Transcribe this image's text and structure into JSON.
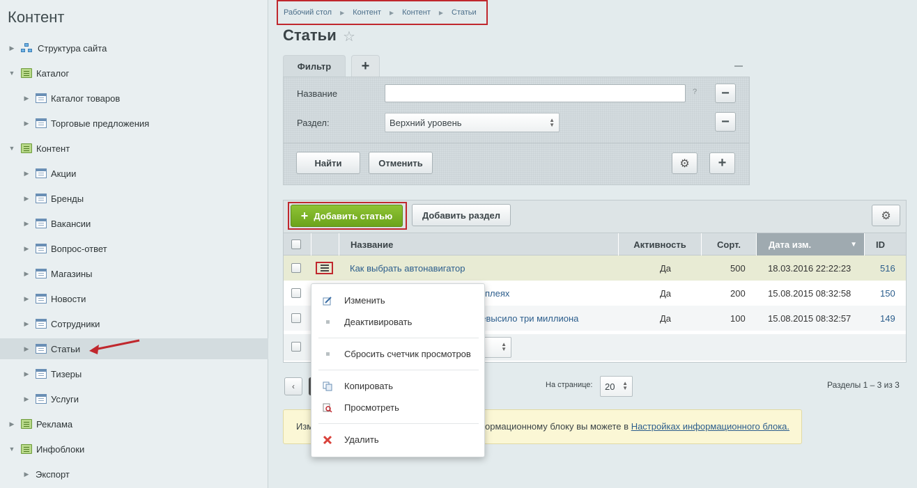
{
  "sidebar": {
    "title": "Контент",
    "items": [
      {
        "label": "Структура сайта",
        "arrow": "▶"
      },
      {
        "label": "Каталог",
        "arrow": "▼"
      },
      {
        "label": "Каталог товаров",
        "arrow": "▶"
      },
      {
        "label": "Торговые предложения",
        "arrow": "▶"
      },
      {
        "label": "Контент",
        "arrow": "▼"
      },
      {
        "label": "Акции",
        "arrow": "▶"
      },
      {
        "label": "Бренды",
        "arrow": "▶"
      },
      {
        "label": "Вакансии",
        "arrow": "▶"
      },
      {
        "label": "Вопрос-ответ",
        "arrow": "▶"
      },
      {
        "label": "Магазины",
        "arrow": "▶"
      },
      {
        "label": "Новости",
        "arrow": "▶"
      },
      {
        "label": "Сотрудники",
        "arrow": "▶"
      },
      {
        "label": "Статьи",
        "arrow": "▶"
      },
      {
        "label": "Тизеры",
        "arrow": "▶"
      },
      {
        "label": "Услуги",
        "arrow": "▶"
      },
      {
        "label": "Реклама",
        "arrow": "▶"
      },
      {
        "label": "Инфоблоки",
        "arrow": "▼"
      },
      {
        "label": "Экспорт",
        "arrow": "▶"
      }
    ],
    "active_item": "Статьи"
  },
  "breadcrumb": [
    "Рабочий стол",
    "Контент",
    "Контент",
    "Статьи"
  ],
  "page_title": "Статьи",
  "filter": {
    "tab_label": "Фильтр",
    "add_tab": "+",
    "name_label": "Название",
    "name_value": "",
    "help": "?",
    "section_label": "Раздел:",
    "section_value": "Верхний уровень",
    "find_button": "Найти",
    "cancel_button": "Отменить",
    "minus": "−",
    "plus": "+"
  },
  "toolbar": {
    "add_article": "Добавить статью",
    "add_section": "Добавить раздел"
  },
  "table": {
    "columns": [
      "Название",
      "Активность",
      "Сорт.",
      "Дата изм.",
      "ID"
    ],
    "sorted_column": "Дата изм.",
    "sort_indicator": "▼",
    "rows": [
      {
        "name": "Как выбрать автонавигатор",
        "active": "Да",
        "sort": "500",
        "date": "18.03.2016 22:22:23",
        "id": "516"
      },
      {
        "name": "плеях",
        "active": "Да",
        "sort": "200",
        "date": "15.08.2015 08:32:58",
        "id": "150"
      },
      {
        "name": "ревысило три миллиона",
        "active": "Да",
        "sort": "100",
        "date": "15.08.2015 08:32:57",
        "id": "149"
      }
    ]
  },
  "context_menu": {
    "items": [
      {
        "label": "Изменить",
        "icon": "edit-icon"
      },
      {
        "label": "Деактивировать",
        "icon": "dot"
      },
      {
        "label": "Сбросить счетчик просмотров",
        "icon": "dot"
      },
      {
        "label": "Копировать",
        "icon": "copy-icon"
      },
      {
        "label": "Просмотреть",
        "icon": "view-icon"
      },
      {
        "label": "Удалить",
        "icon": "delete-icon"
      }
    ]
  },
  "pager": {
    "prev": "‹",
    "per_page_label": "На странице:",
    "per_page_value": "20",
    "sections_text": "Разделы 1 – 3 из 3"
  },
  "info": {
    "prefix": "Изм",
    "middle": "ормационному блоку вы можете в",
    "link": "Настройках информационного блока."
  },
  "colors": {
    "accent_green": "#7ab32a",
    "highlight_red": "#c0272d",
    "link_blue": "#2b5d8c"
  }
}
